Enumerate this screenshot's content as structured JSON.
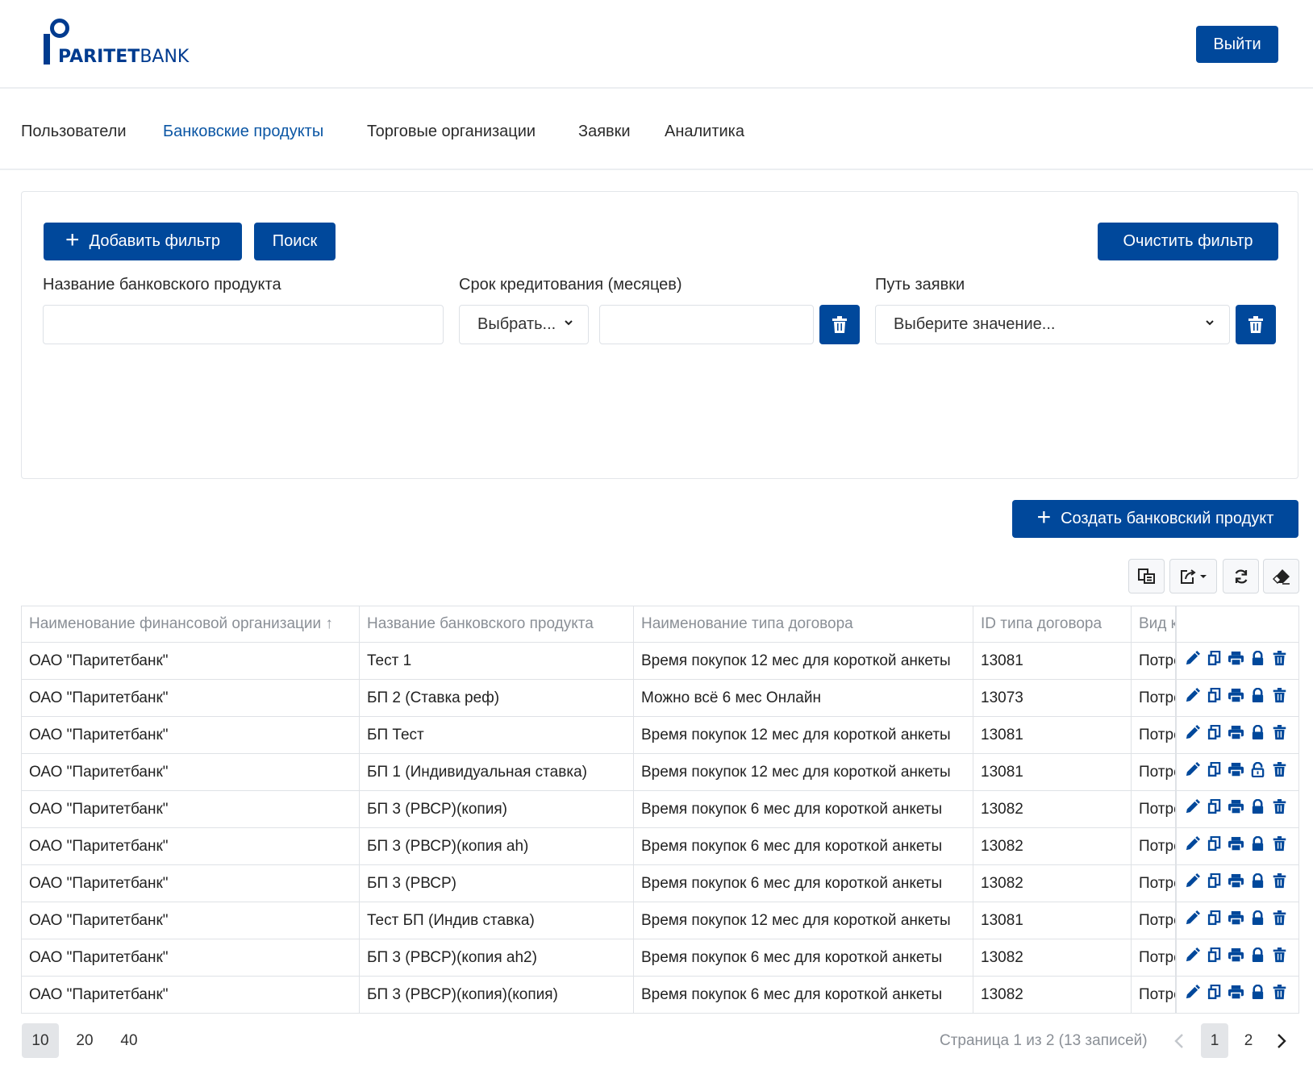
{
  "header": {
    "logo_bold": "PARITET",
    "logo_light": "BANK",
    "logout_label": "Выйти"
  },
  "nav": {
    "items": [
      {
        "label": "Пользователи",
        "active": false
      },
      {
        "label": "Банковские продукты",
        "active": true
      },
      {
        "label": "Торговые организации",
        "active": false
      },
      {
        "label": "Заявки",
        "active": false
      },
      {
        "label": "Аналитика",
        "active": false
      }
    ]
  },
  "filters": {
    "add_filter_label": "Добавить фильтр",
    "search_label": "Поиск",
    "clear_label": "Очистить фильтр",
    "product_name_label": "Название банковского продукта",
    "product_name_value": "",
    "term_label": "Срок кредитования (месяцев)",
    "term_operator": "Выбрать...",
    "term_value": "",
    "path_label": "Путь заявки",
    "path_value": "Выберите значение..."
  },
  "create_button_label": "Создать банковский продукт",
  "toolbar": {
    "icons": [
      "columns-icon",
      "export-icon",
      "refresh-icon",
      "eraser-icon"
    ]
  },
  "table": {
    "columns": [
      "Наименование финансовой организации",
      "Название банковского продукта",
      "Наименование типа договора",
      "ID типа договора",
      "Вид кредитования"
    ],
    "sort_indicator": "↑",
    "rows": [
      {
        "org": "ОАО \"Паритетбанк\"",
        "product": "Тест 1",
        "contract": "Время покупок 12 мес для короткой анкеты",
        "id": "13081",
        "kind": "Потребительский",
        "locked": true
      },
      {
        "org": "ОАО \"Паритетбанк\"",
        "product": "БП 2 (Ставка реф)",
        "contract": "Можно всё 6 мес Онлайн",
        "id": "13073",
        "kind": "Потребительский",
        "locked": true
      },
      {
        "org": "ОАО \"Паритетбанк\"",
        "product": "БП Тест",
        "contract": "Время покупок 12 мес для короткой анкеты",
        "id": "13081",
        "kind": "Потребительский",
        "locked": true
      },
      {
        "org": "ОАО \"Паритетбанк\"",
        "product": "БП 1 (Индивидуальная ставка)",
        "contract": "Время покупок 12 мес для короткой анкеты",
        "id": "13081",
        "kind": "Потребительский",
        "locked": false
      },
      {
        "org": "ОАО \"Паритетбанк\"",
        "product": "БП 3 (РВСР)(копия)",
        "contract": "Время покупок 6 мес для короткой анкеты",
        "id": "13082",
        "kind": "Потребительский",
        "locked": true
      },
      {
        "org": "ОАО \"Паритетбанк\"",
        "product": "БП 3 (РВСР)(копия ah)",
        "contract": "Время покупок 6 мес для короткой анкеты",
        "id": "13082",
        "kind": "Потребительский",
        "locked": true
      },
      {
        "org": "ОАО \"Паритетбанк\"",
        "product": "БП 3 (РВСР)",
        "contract": "Время покупок 6 мес для короткой анкеты",
        "id": "13082",
        "kind": "Потребительский",
        "locked": true
      },
      {
        "org": "ОАО \"Паритетбанк\"",
        "product": "Тест БП (Индив ставка)",
        "contract": "Время покупок 12 мес для короткой анкеты",
        "id": "13081",
        "kind": "Потребительский",
        "locked": true
      },
      {
        "org": "ОАО \"Паритетбанк\"",
        "product": "БП 3 (РВСР)(копия ah2)",
        "contract": "Время покупок 6 мес для короткой анкеты",
        "id": "13082",
        "kind": "Потребительский",
        "locked": true
      },
      {
        "org": "ОАО \"Паритетбанк\"",
        "product": "БП 3 (РВСР)(копия)(копия)",
        "contract": "Время покупок 6 мес для короткой анкеты",
        "id": "13082",
        "kind": "Потребительский",
        "locked": true
      }
    ]
  },
  "pagination": {
    "page_sizes": [
      "10",
      "20",
      "40"
    ],
    "active_size": "10",
    "info": "Страница 1 из 2 (13 записей)",
    "pages": [
      "1",
      "2"
    ],
    "current_page": "1"
  },
  "colors": {
    "primary": "#00489b",
    "active_nav": "#0b56a4"
  }
}
